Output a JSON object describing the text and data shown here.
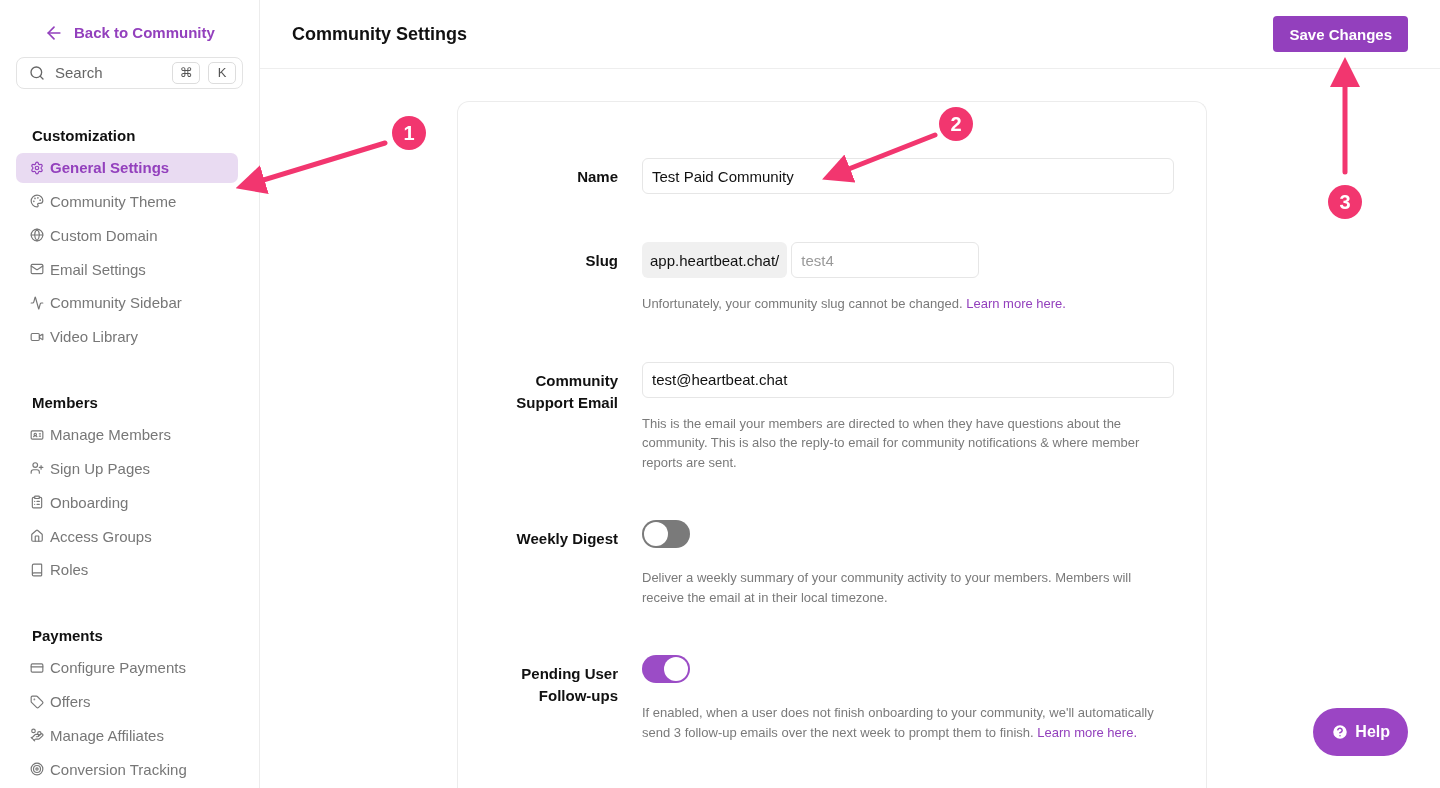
{
  "sidebar": {
    "back_link": "Back to Community",
    "search": {
      "placeholder": "Search",
      "shortcut_keys": [
        "⌘",
        "K"
      ]
    },
    "sections": [
      {
        "title": "Customization",
        "items": [
          {
            "label": "General Settings",
            "selected": true
          },
          {
            "label": "Community Theme",
            "selected": false
          },
          {
            "label": "Custom Domain",
            "selected": false
          },
          {
            "label": "Email Settings",
            "selected": false
          },
          {
            "label": "Community Sidebar",
            "selected": false
          },
          {
            "label": "Video Library",
            "selected": false
          }
        ]
      },
      {
        "title": "Members",
        "items": [
          {
            "label": "Manage Members",
            "selected": false
          },
          {
            "label": "Sign Up Pages",
            "selected": false
          },
          {
            "label": "Onboarding",
            "selected": false
          },
          {
            "label": "Access Groups",
            "selected": false
          },
          {
            "label": "Roles",
            "selected": false
          }
        ]
      },
      {
        "title": "Payments",
        "items": [
          {
            "label": "Configure Payments",
            "selected": false
          },
          {
            "label": "Offers",
            "selected": false
          },
          {
            "label": "Manage Affiliates",
            "selected": false
          },
          {
            "label": "Conversion Tracking",
            "selected": false
          }
        ]
      }
    ]
  },
  "header": {
    "title": "Community Settings",
    "save_button": "Save Changes"
  },
  "settings": [
    {
      "kind": "text",
      "label": "Name",
      "value": "Test Paid Community"
    },
    {
      "kind": "slug",
      "label": "Slug",
      "prefix": "app.heartbeat.chat/",
      "placeholder": "test4",
      "help": "Unfortunately, your community slug cannot be changed.",
      "help_link": "Learn more here."
    },
    {
      "kind": "text",
      "label": "Community Support Email",
      "value": "test@heartbeat.chat",
      "help": "This is the email your members are directed to when they have questions about the community. This is also the reply-to email for community notifications & where member reports are sent."
    },
    {
      "kind": "toggle",
      "label": "Weekly Digest",
      "on": false,
      "help": "Deliver a weekly summary of your community activity to your members. Members will receive the email at in their local timezone."
    },
    {
      "kind": "toggle",
      "label": "Pending User Follow-ups",
      "on": true,
      "help": "If enabled, when a user does not finish onboarding to your community, we'll automatically send 3 follow-up emails over the next week to prompt them to finish.",
      "help_link": "Learn more here."
    }
  ],
  "help_button": "Help",
  "annotations": [
    "1",
    "2",
    "3"
  ]
}
